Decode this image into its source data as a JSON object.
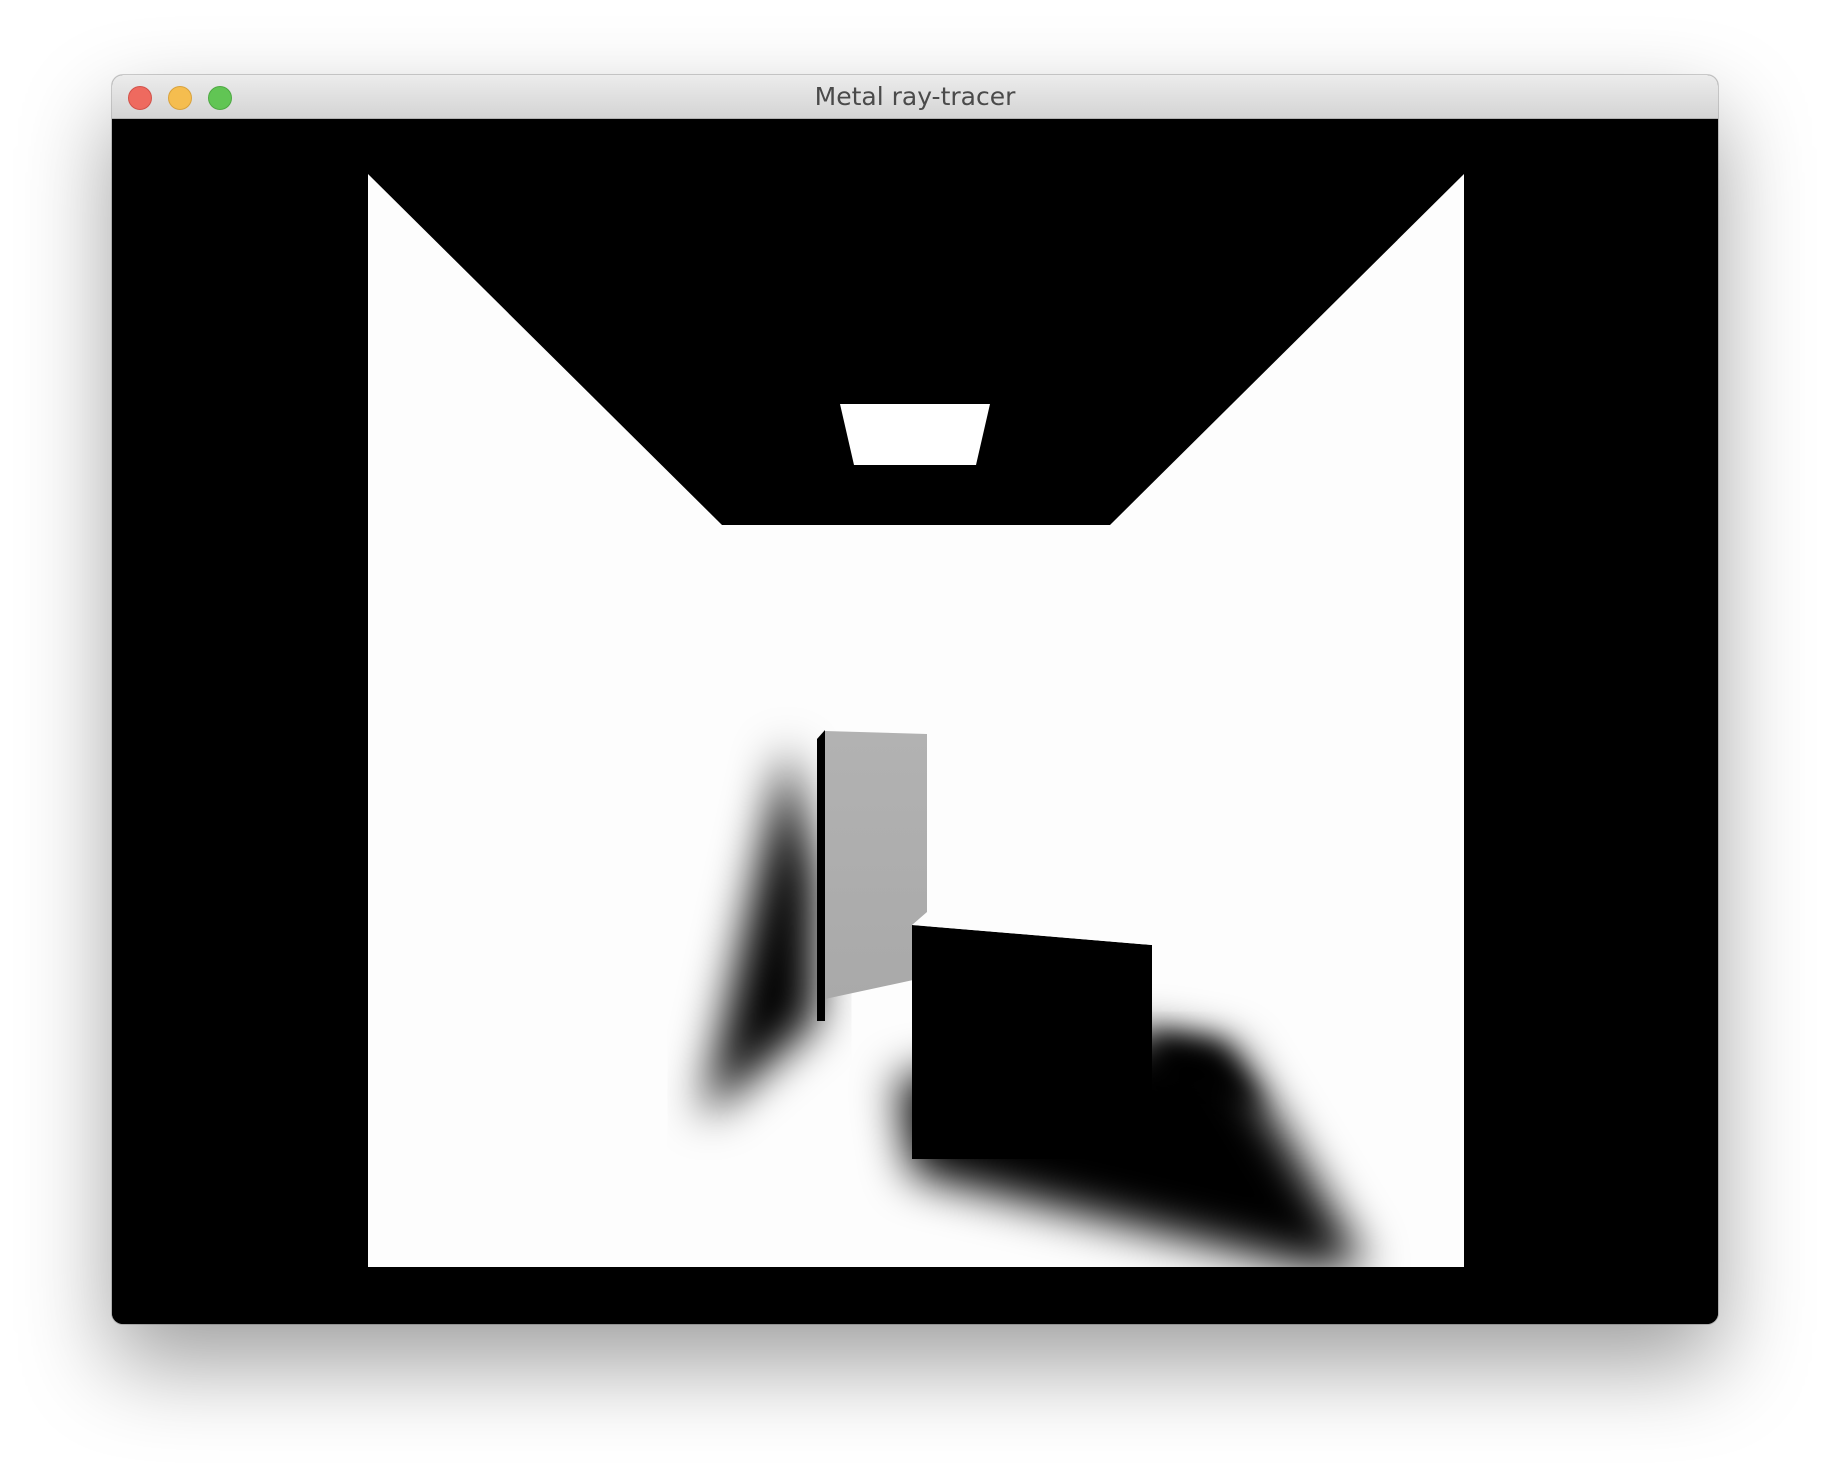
{
  "window": {
    "title": "Metal ray-tracer",
    "controls": [
      "close",
      "minimize",
      "zoom"
    ]
  },
  "render": {
    "background_color": "#000000",
    "surface_color": "#fdfdfd",
    "light_color": "#ffffff",
    "tall_block_face_color": "#adadad",
    "shadow_color": "#000000"
  }
}
